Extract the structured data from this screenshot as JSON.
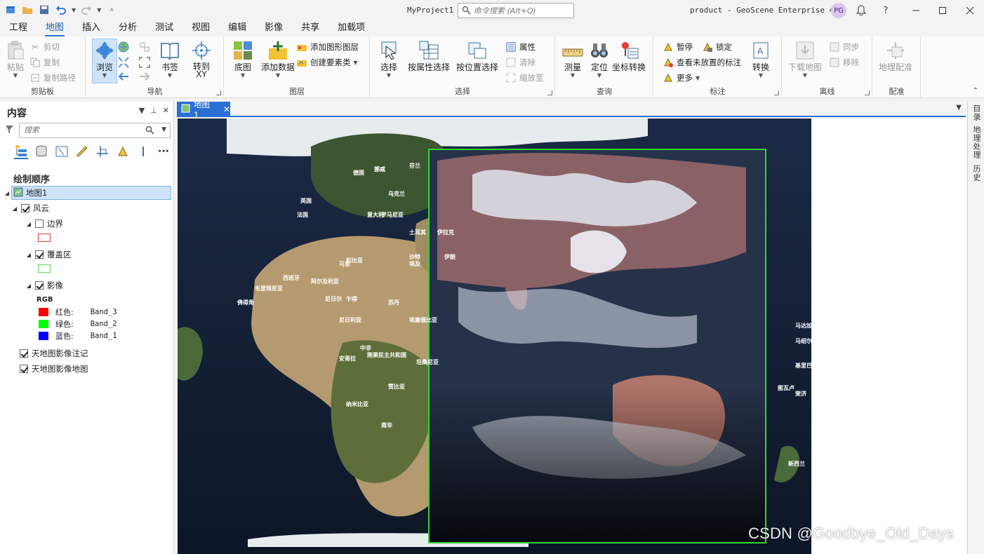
{
  "titlebar": {
    "project": "MyProject1",
    "command_search_placeholder": "命令搜索 (Alt+Q)",
    "product": "product - GeoScene Enterprise 4.0",
    "user_initials": "PG"
  },
  "ribbon_tabs": [
    "工程",
    "地图",
    "插入",
    "分析",
    "测试",
    "视图",
    "编辑",
    "影像",
    "共享",
    "加载项"
  ],
  "active_tab": "地图",
  "ribbon": {
    "clipboard": {
      "label": "剪贴板",
      "paste": "粘贴",
      "cut": "剪切",
      "copy": "复制",
      "copy_path": "复制路径"
    },
    "navigate": {
      "label": "导航",
      "explore": "浏览",
      "bookmarks": "书签",
      "goto_xy": "转到\nXY"
    },
    "layer": {
      "label": "图层",
      "basemap": "底图",
      "add_data": "添加数据",
      "add_graphics_layer": "添加图形图层",
      "create_feature_class": "创建要素类"
    },
    "selection": {
      "label": "选择",
      "select": "选择",
      "select_by_attr": "按属性选择",
      "select_by_location": "按位置选择",
      "attributes": "属性",
      "clear": "清除",
      "zoom_to": "缩放至"
    },
    "inquiry": {
      "label": "查询",
      "measure": "测量",
      "locate": "定位",
      "coord_convert": "坐标转换"
    },
    "labeling": {
      "label": "标注",
      "pause": "暂停",
      "lock": "锁定",
      "view_unplaced": "查看未放置的标注",
      "more": "更多",
      "convert": "转换"
    },
    "offline": {
      "label": "离线",
      "download_map": "下载地图",
      "sync": "同步",
      "remove": "移除"
    },
    "georef": {
      "label": "配准",
      "georeference": "地理配准"
    }
  },
  "contents": {
    "title": "内容",
    "search_placeholder": "搜索",
    "drawing_order": "绘制顺序",
    "map": "地图1",
    "group": "风云",
    "layers": [
      {
        "name": "边界",
        "checked": false,
        "symbol_color": "#e53935"
      },
      {
        "name": "覆盖区",
        "checked": true,
        "symbol_color": "#5bdc5b"
      },
      {
        "name": "影像",
        "checked": true
      }
    ],
    "rgb_label": "RGB",
    "bands": [
      {
        "label": "红色:",
        "band": "Band_3",
        "color": "#ff0000"
      },
      {
        "label": "绿色:",
        "band": "Band_2",
        "color": "#00ff00"
      },
      {
        "label": "蓝色:",
        "band": "Band_1",
        "color": "#0000ff"
      }
    ],
    "basemap_layers": [
      {
        "name": "天地图影像注记",
        "checked": true
      },
      {
        "name": "天地图影像地图",
        "checked": true
      }
    ]
  },
  "map_tab": "地图1",
  "side_dock": [
    "目录",
    "地理处理",
    "历史"
  ],
  "map_labels": [
    "德国",
    "法国",
    "意大利",
    "罗马尼亚",
    "西班牙",
    "阿尔及利亚",
    "利比亚",
    "埃及",
    "毛里塔尼亚",
    "尼日尔",
    "乍得",
    "苏丹",
    "尼日利亚",
    "埃塞俄比亚",
    "中非",
    "刚果民主共和国",
    "坦桑尼亚",
    "安哥拉",
    "赞比亚",
    "纳米比亚",
    "南非",
    "马里",
    "佛得角",
    "马达加斯加",
    "马绍尔群岛",
    "基里巴斯",
    "图瓦卢",
    "斐济",
    "新西兰",
    "英国",
    "挪威",
    "芬兰",
    "乌克兰",
    "土耳其",
    "伊拉克",
    "伊朗",
    "沙特"
  ],
  "watermark": "CSDN @Goodbye_Old_Days"
}
